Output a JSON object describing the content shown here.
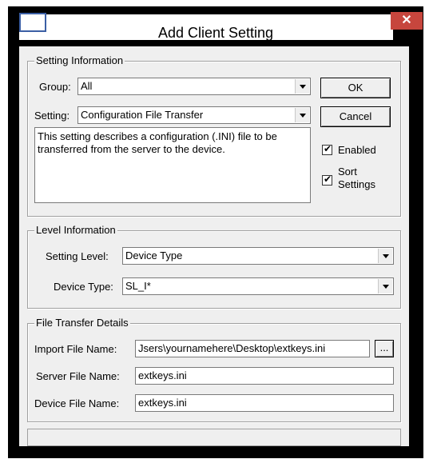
{
  "window": {
    "title": "Add Client Setting",
    "close_glyph": "✕"
  },
  "setting_info": {
    "legend": "Setting Information",
    "group_label": "Group:",
    "group_value": "All",
    "setting_label": "Setting:",
    "setting_value": "Configuration File Transfer",
    "description": "This setting describes a configuration (.INI) file to be transferred from the server to the device.",
    "ok_label": "OK",
    "cancel_label": "Cancel",
    "enabled_label": "Enabled",
    "enabled_checked": true,
    "sort_label_line1": "Sort",
    "sort_label_line2": "Settings",
    "sort_checked": true
  },
  "level_info": {
    "legend": "Level Information",
    "setting_level_label": "Setting Level:",
    "setting_level_value": "Device Type",
    "device_type_label": "Device Type:",
    "device_type_value": "SL_I*"
  },
  "file_transfer": {
    "legend": "File Transfer Details",
    "import_label": "Import File Name:",
    "import_value": "Jsers\\yournamehere\\Desktop\\extkeys.ini",
    "browse_label": "...",
    "server_label": "Server File Name:",
    "server_value": "extkeys.ini",
    "device_label": "Device File Name:",
    "device_value": "extkeys.ini"
  },
  "icons": {
    "title_icon": "window-icon",
    "close_icon": "close-icon",
    "dropdown_icon": "chevron-down-icon",
    "checkbox_icon": "checkmark-icon"
  },
  "colors": {
    "close_button": "#c7463d",
    "dialog_background": "#efefef"
  }
}
